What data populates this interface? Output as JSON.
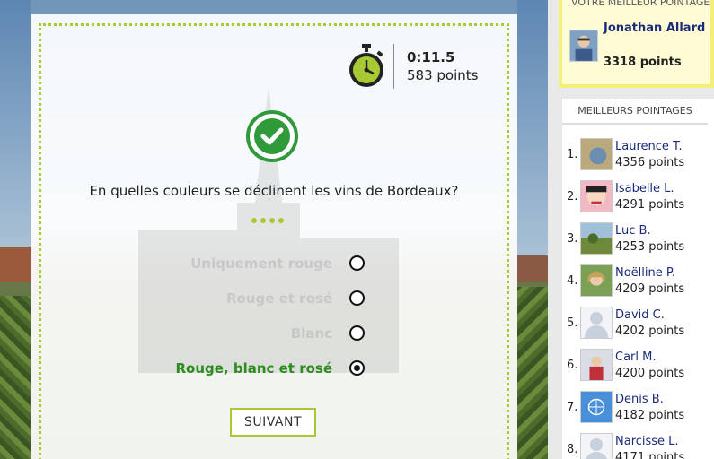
{
  "quiz": {
    "timer": {
      "time": "0:11.5",
      "points": "583 points"
    },
    "question": "En quelles couleurs se déclinent les vins de Bordeaux?",
    "answers": [
      {
        "label": "Uniquement rouge",
        "selected": false,
        "correct": false
      },
      {
        "label": "Rouge et rosé",
        "selected": false,
        "correct": false
      },
      {
        "label": "Blanc",
        "selected": false,
        "correct": false
      },
      {
        "label": "Rouge, blanc et rosé",
        "selected": true,
        "correct": true
      }
    ],
    "next_label": "SUIVANT",
    "accent_color": "#a9c934",
    "correct_color": "#2e8b1f"
  },
  "best_score": {
    "title": "VOTRE MEILLEUR POINTAGE",
    "name": "Jonathan Allard",
    "points": "3318 points"
  },
  "leaderboard": {
    "title": "MEILLEURS POINTAGES",
    "entries": [
      {
        "rank": "1.",
        "name": "Laurence T.",
        "points": "4356 points"
      },
      {
        "rank": "2.",
        "name": "Isabelle L.",
        "points": "4291 points"
      },
      {
        "rank": "3.",
        "name": "Luc B.",
        "points": "4253 points"
      },
      {
        "rank": "4.",
        "name": "Noëlline P.",
        "points": "4209 points"
      },
      {
        "rank": "5.",
        "name": "David C.",
        "points": "4202 points"
      },
      {
        "rank": "6.",
        "name": "Carl M.",
        "points": "4200 points"
      },
      {
        "rank": "7.",
        "name": "Denis B.",
        "points": "4182 points"
      },
      {
        "rank": "8.",
        "name": "Narcisse L.",
        "points": "4171 points"
      }
    ]
  }
}
